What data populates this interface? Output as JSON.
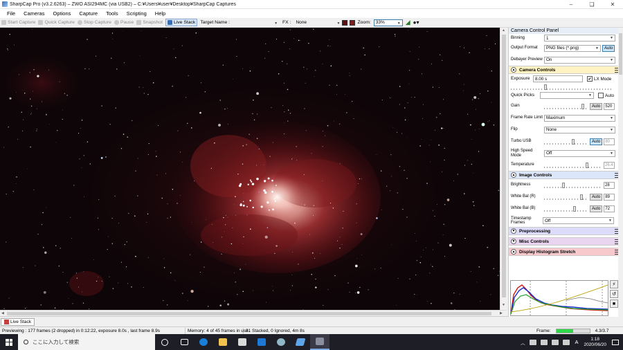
{
  "window": {
    "title": "SharpCap Pro (v3.2.6263) – ZWO ASI294MC (via USB2) – C:¥Users¥user¥Desktop¥SharpCap Captures",
    "minimize": "–",
    "maximize": "❏",
    "close": "✕"
  },
  "menu": [
    "File",
    "Cameras",
    "Options",
    "Capture",
    "Tools",
    "Scripting",
    "Help"
  ],
  "toolbar": {
    "start_capture": "Start Capture",
    "quick_capture": "Quick Capture",
    "stop_capture": "Stop Capture",
    "pause": "Pause",
    "snapshot": "Snapshot",
    "live_stack": "Live Stack",
    "target_name_label": "Target Name :",
    "target_name_value": "",
    "fx_label": "FX :",
    "fx_value": "None",
    "zoom_label": "Zoom:",
    "zoom_value": "33%"
  },
  "panel": {
    "title": "Camera Control Panel",
    "binning_label": "Binning",
    "binning_value": "1",
    "output_format_label": "Output Format",
    "output_format_value": "PNG files (*.png)",
    "output_auto": "Auto",
    "debayer_label": "Debayer Preview",
    "debayer_value": "On",
    "sections": {
      "camera_controls": "Camera Controls",
      "image_controls": "Image Controls",
      "preprocessing": "Preprocessing",
      "misc_controls": "Misc Controls",
      "display_histogram": "Display Histogram Stretch"
    },
    "exposure_label": "Exposure",
    "exposure_value": "8.00 s",
    "lx_mode_label": "LX Mode",
    "lx_mode_checked": "✔",
    "quick_picks_label": "Quick Picks",
    "quick_picks_auto": "Auto",
    "gain_label": "Gain",
    "gain_auto": "Auto",
    "gain_value": "520",
    "frame_rate_label": "Frame Rate Limit",
    "frame_rate_value": "Maximum",
    "flip_label": "Flip",
    "flip_value": "None",
    "turbo_label": "Turbo USB",
    "turbo_auto": "Auto",
    "turbo_value": "80",
    "high_speed_label": "High Speed Mode",
    "high_speed_value": "Off",
    "temperature_label": "Temperature",
    "temperature_value": "26.4",
    "brightness_label": "Brightness",
    "brightness_value": "28",
    "wb_r_label": "White Bal (R)",
    "wb_r_auto": "Auto",
    "wb_r_value": "89",
    "wb_b_label": "White Bal (B)",
    "wb_b_auto": "Auto",
    "wb_b_value": "72",
    "timestamp_label": "Timestamp Frames",
    "timestamp_value": "Off"
  },
  "live_stack_tab": "Live Stack",
  "status": {
    "previewing": "Previewing : 177 frames (2 dropped) in 0:12:22, exposure 8.0s , last frame 8.9s",
    "memory": "Memory: 4 of 45 frames in use.",
    "stacked": "31 Stacked, 0 Ignored, 4m 8s",
    "frame_label": "Frame:",
    "frame_progress": 0.5,
    "frame_time": "4.3/3.7"
  },
  "taskbar": {
    "search_placeholder": "ここに入力して検索",
    "ime": "A",
    "time": "1:18",
    "date": "2020/06/20"
  }
}
